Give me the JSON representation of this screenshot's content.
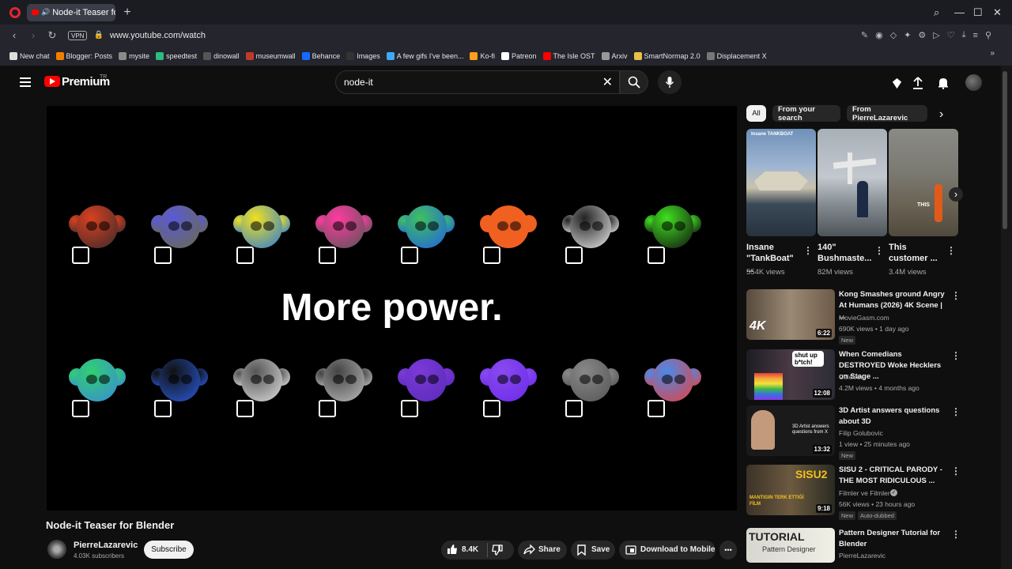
{
  "browser": {
    "tab_title": "Node-it Teaser for Ble",
    "url": "www.youtube.com/watch",
    "vpn_label": "VPN",
    "bookmarks": [
      {
        "label": "New chat",
        "color": "#dddddd"
      },
      {
        "label": "Blogger: Posts",
        "color": "#f57d00"
      },
      {
        "label": "mysite",
        "color": "#8a8a8a"
      },
      {
        "label": "speedtest",
        "color": "#2bbd7e"
      },
      {
        "label": "dinowall",
        "color": "#555555"
      },
      {
        "label": "museumwall",
        "color": "#c0392b"
      },
      {
        "label": "Behance",
        "color": "#1769ff"
      },
      {
        "label": "Images",
        "color": "#333333"
      },
      {
        "label": "A few gifs I've been...",
        "color": "#3fa9f5"
      },
      {
        "label": "Ko-fi",
        "color": "#ff9f1c"
      },
      {
        "label": "Patreon",
        "color": "#ffffff"
      },
      {
        "label": "The Isle OST",
        "color": "#ff0000"
      },
      {
        "label": "Arxiv",
        "color": "#999999"
      },
      {
        "label": "SmartNormap 2.0",
        "color": "#e8c14a"
      },
      {
        "label": "Displacement X",
        "color": "#777777"
      }
    ]
  },
  "yt": {
    "brand": "Premium",
    "brand_sup": "TR",
    "search_value": "node-it",
    "player_text": "More power.",
    "video_title": "Node-it Teaser for Blender",
    "channel_name": "PierreLazarevic",
    "channel_subs": "4.03K subscribers",
    "subscribe_label": "Subscribe",
    "like_count": "8.4K",
    "share_label": "Share",
    "save_label": "Save",
    "download_label": "Download to Mobile",
    "more_label": "•••"
  },
  "chips": [
    "All",
    "From your search",
    "From PierreLazarevic"
  ],
  "shorts": [
    {
      "title": "Insane \"TankBoat\" ...",
      "views": "554K views"
    },
    {
      "title": "140\" Bushmaste...",
      "views": "82M views"
    },
    {
      "title": "This customer ...",
      "views": "3.4M views"
    }
  ],
  "recs": [
    {
      "title": "Kong Smashes ground Angry At Humans (2026) 4K Scene | ...",
      "channel": "MovieGasm.com",
      "meta": "690K views • 1 day ago",
      "badge": "New",
      "duration": "6:22"
    },
    {
      "title": "When Comedians DESTROYED Woke Hecklers on Stage ...",
      "channel": "CeleVox",
      "meta": "4.2M views • 4 months ago",
      "badge": "",
      "duration": "12:08"
    },
    {
      "title": "3D Artist answers questions about 3D",
      "channel": "Filip Golubovic",
      "meta": "1 view • 25 minutes ago",
      "badge": "New",
      "duration": "13:32"
    },
    {
      "title": "SISU 2 - CRITICAL PARODY - THE MOST RIDICULOUS ...",
      "channel": "Filmler ve Filmler",
      "meta": "56K views • 23 hours ago",
      "badge": "New",
      "badge2": "Auto-dubbed",
      "duration": "9:18"
    },
    {
      "title": "Pattern Designer Tutorial for Blender",
      "channel": "PierreLazarevic",
      "meta": "",
      "badge": "",
      "duration": ""
    }
  ],
  "thumb_texts": {
    "rec0": "4K",
    "rec1": "shut up b*tch!",
    "rec2": "3D Artist answers questions from X",
    "rec3": "SISU2",
    "rec3b": "MANTIGIN TERK ETTIĞİ FİLM",
    "rec4a": "TUTORIAL",
    "rec4b": "Pattern Designer",
    "short0": "Insane TANKBOAT",
    "short2": "THIS"
  }
}
